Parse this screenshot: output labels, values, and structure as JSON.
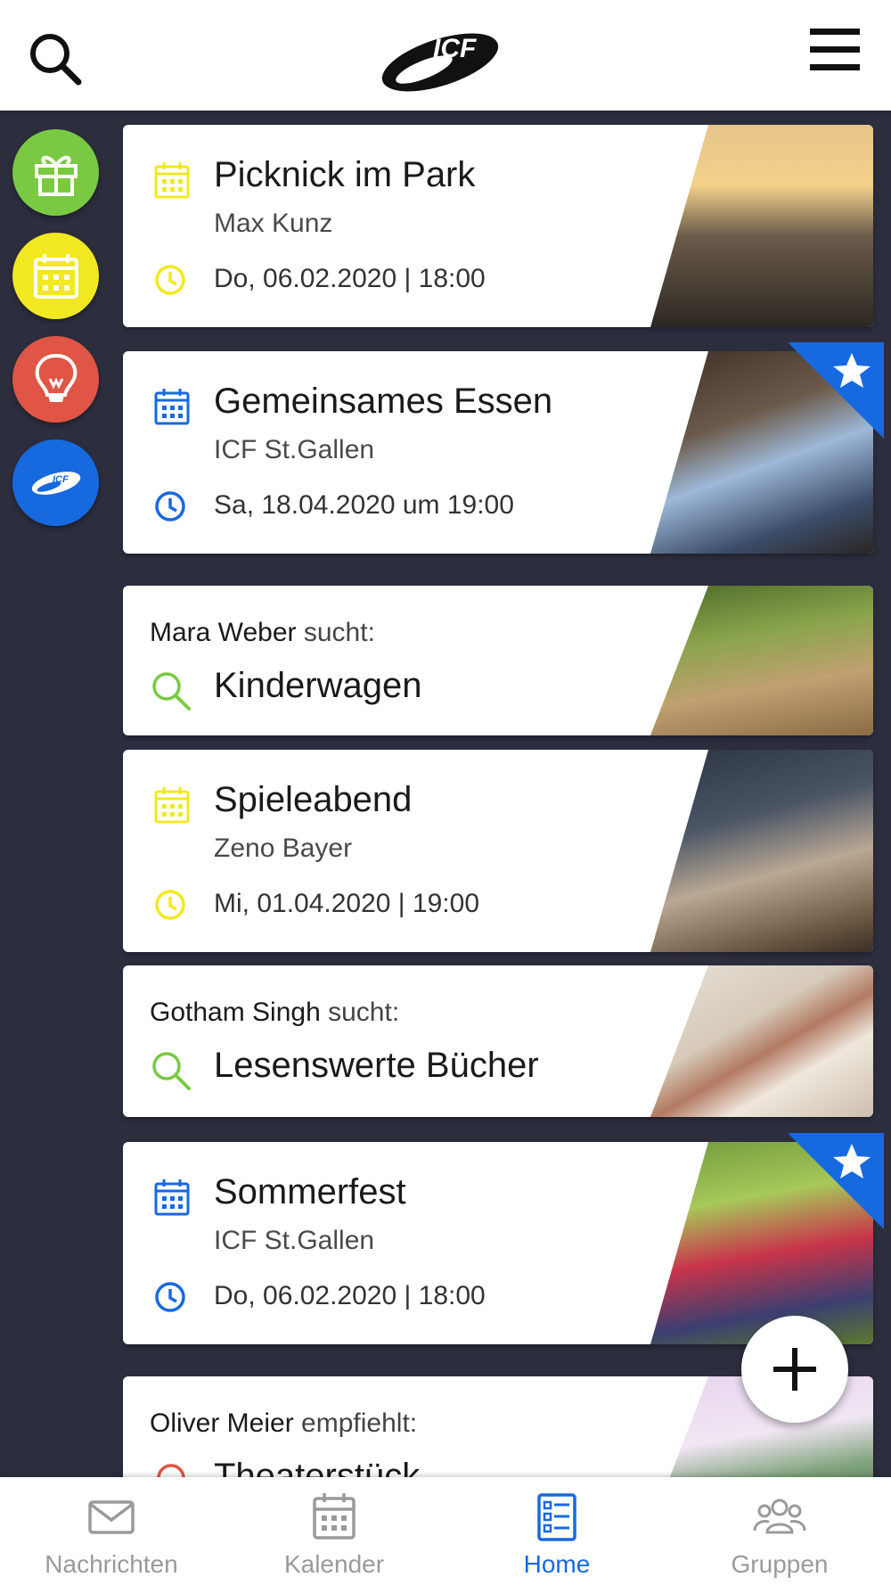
{
  "header": {
    "logo_text": "ICF"
  },
  "colors": {
    "accent_blue": "#1769e0",
    "yellow": "#f2e821",
    "green": "#7ac943",
    "red": "#e05545",
    "dark_bg": "#2c2e3e"
  },
  "sidebar": {
    "items": [
      {
        "icon": "gift-icon",
        "color": "#7ac943"
      },
      {
        "icon": "calendar-icon",
        "color": "#f2e821"
      },
      {
        "icon": "lightbulb-icon",
        "color": "#e05545"
      },
      {
        "icon": "icf-logo-icon",
        "color": "#1769e0",
        "label": "ICF"
      }
    ]
  },
  "feed": {
    "events": [
      {
        "title": "Picknick im Park",
        "organizer": "Max Kunz",
        "datetime": "Do, 06.02.2020 | 18:00"
      },
      {
        "title": "Gemeinsames Essen",
        "organizer": "ICF St.Gallen",
        "datetime": "Sa, 18.04.2020 um 19:00"
      },
      {
        "title": "Spieleabend",
        "organizer": "Zeno Bayer",
        "datetime": "Mi, 01.04.2020 | 19:00"
      },
      {
        "title": "Sommerfest",
        "organizer": "ICF St.Gallen",
        "datetime": "Do, 06.02.2020 | 18:00"
      }
    ],
    "requests": [
      {
        "person": "Mara Weber",
        "verb": "sucht:",
        "title": "Kinderwagen"
      },
      {
        "person": "Gotham Singh",
        "verb": "sucht:",
        "title": "Lesenswerte Bücher"
      },
      {
        "person": "Oliver Meier",
        "verb": "empfiehlt:",
        "title": "Theaterstück"
      }
    ]
  },
  "bottom_nav": {
    "items": [
      {
        "label": "Nachrichten",
        "icon": "envelope-icon"
      },
      {
        "label": "Kalender",
        "icon": "calendar-icon"
      },
      {
        "label": "Home",
        "icon": "list-icon",
        "active": true
      },
      {
        "label": "Gruppen",
        "icon": "group-icon"
      }
    ]
  }
}
